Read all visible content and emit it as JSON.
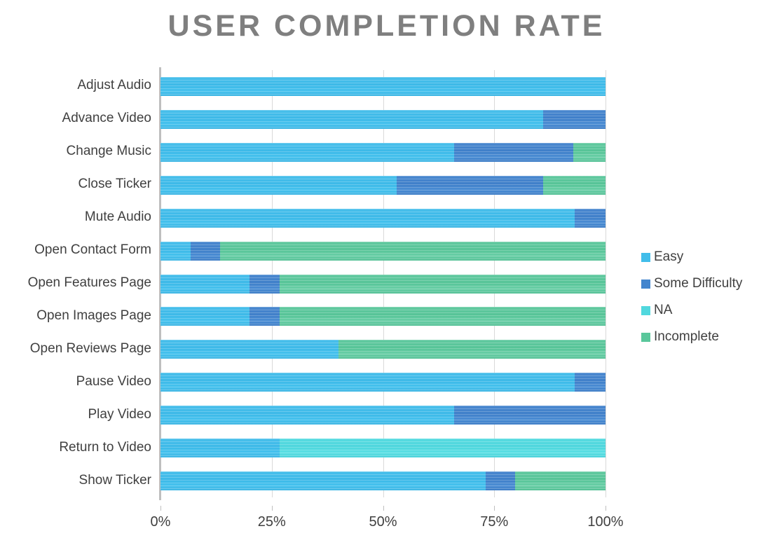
{
  "chart_data": {
    "type": "bar",
    "subtype": "stacked-horizontal-100percent",
    "title": "USER COMPLETION RATE",
    "xlabel": "",
    "ylabel": "",
    "xlim": [
      0,
      100
    ],
    "xtick_labels": [
      "0%",
      "25%",
      "50%",
      "75%",
      "100%"
    ],
    "xtick_values": [
      0,
      25,
      50,
      75,
      100
    ],
    "grid": true,
    "grid_axis": "x",
    "legend_position": "right",
    "categories": [
      "Adjust Audio",
      "Advance Video",
      "Change Music",
      "Close Ticker",
      "Mute Audio",
      "Open Contact Form",
      "Open Features Page",
      "Open Images Page",
      "Open Reviews Page",
      "Pause Video",
      "Play Video",
      "Return to Video",
      "Show Ticker"
    ],
    "series": [
      {
        "name": "Easy",
        "color": "#41bdea",
        "values": [
          100,
          86,
          66,
          53,
          93,
          6.7,
          20,
          20,
          40,
          93,
          66,
          26.7,
          73
        ]
      },
      {
        "name": "Some Difficulty",
        "color": "#4285ce",
        "values": [
          0,
          14,
          26.7,
          33,
          7,
          6.7,
          6.7,
          6.7,
          0,
          7,
          34,
          0,
          6.7
        ]
      },
      {
        "name": "NA",
        "color": "#51d8de",
        "values": [
          0,
          0,
          0,
          0,
          0,
          0,
          0,
          0,
          0,
          0,
          0,
          73.3,
          0
        ]
      },
      {
        "name": "Incomplete",
        "color": "#5ac79b",
        "values": [
          0,
          0,
          7.3,
          14,
          0,
          86.6,
          73.3,
          73.3,
          60,
          0,
          0,
          0,
          20.3
        ]
      }
    ]
  },
  "legend": {
    "items": [
      {
        "label": "Easy",
        "color": "#41bdea"
      },
      {
        "label": "Some Difficulty",
        "color": "#4285ce"
      },
      {
        "label": "NA",
        "color": "#51d8de"
      },
      {
        "label": "Incomplete",
        "color": "#5ac79b"
      }
    ]
  }
}
